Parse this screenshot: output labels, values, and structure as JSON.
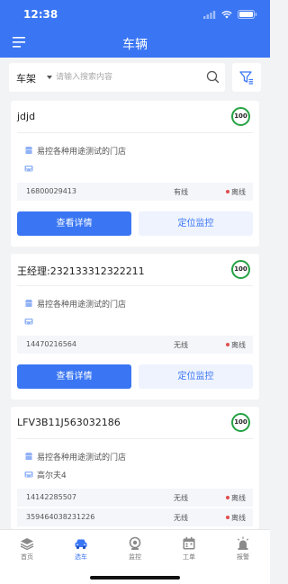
{
  "status_bar": {
    "time": "12:38"
  },
  "header": {
    "title": "车辆"
  },
  "search": {
    "type_label": "车架",
    "placeholder": "请输入搜索内容"
  },
  "vehicles": [
    {
      "title": "jdjd",
      "score": "100",
      "store": "易控各种用途测试的门店",
      "plate": "",
      "devices": [
        {
          "id": "16800029413",
          "connection": "有线",
          "status": "离线"
        }
      ],
      "detail_label": "查看详情",
      "locate_label": "定位监控"
    },
    {
      "title": "王经理:232133312322211",
      "score": "100",
      "store": "易控各种用途测试的门店",
      "plate": "",
      "devices": [
        {
          "id": "14470216564",
          "connection": "无线",
          "status": "离线"
        }
      ],
      "detail_label": "查看详情",
      "locate_label": "定位监控"
    },
    {
      "title": "LFV3B11J563032186",
      "score": "100",
      "store": "易控各种用途测试的门店",
      "plate": "高尔夫4",
      "devices": [
        {
          "id": "14142285507",
          "connection": "无线",
          "status": "离线"
        },
        {
          "id": "359464038231226",
          "connection": "无线",
          "status": "离线"
        }
      ]
    }
  ],
  "tabbar": {
    "items": [
      {
        "label": "首页",
        "icon": "layers-icon"
      },
      {
        "label": "选车",
        "icon": "car-icon",
        "active": true
      },
      {
        "label": "监控",
        "icon": "camera-icon"
      },
      {
        "label": "工单",
        "icon": "calendar-icon"
      },
      {
        "label": "报警",
        "icon": "alarm-icon"
      }
    ]
  },
  "colors": {
    "primary": "#3a76f3",
    "score_ring": "#25a243",
    "offline_dot": "#e24c4c"
  }
}
